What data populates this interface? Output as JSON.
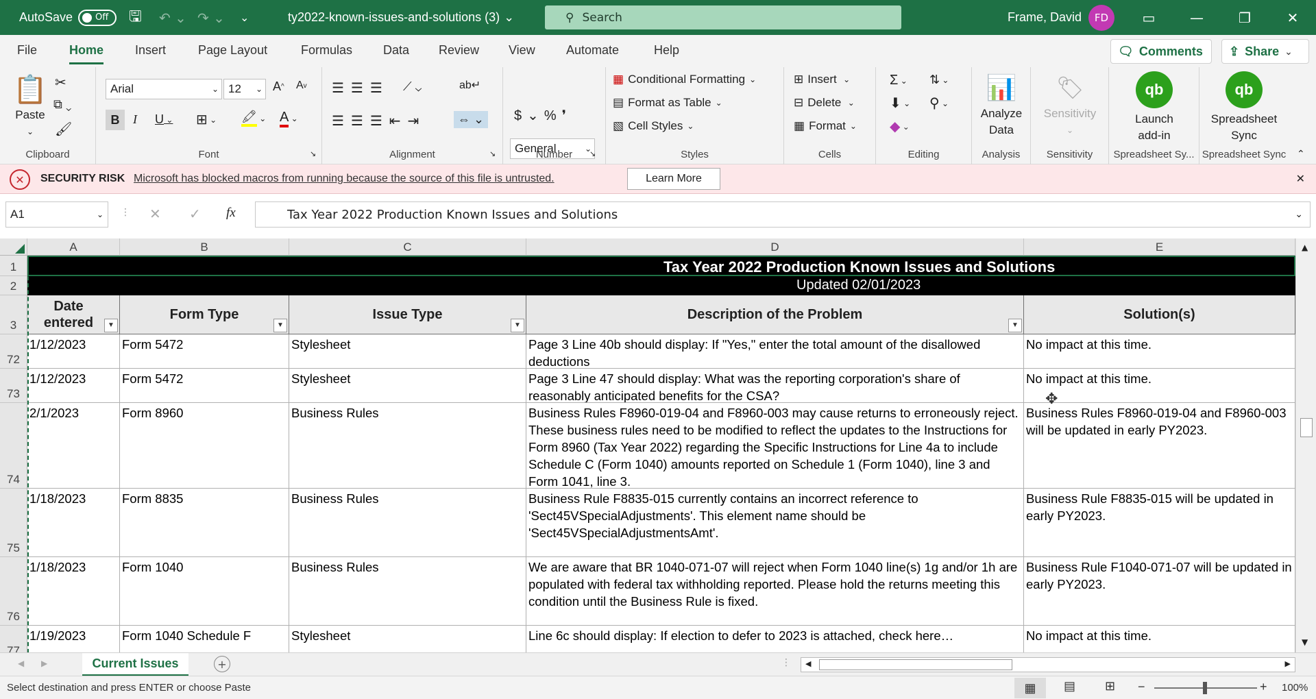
{
  "titlebar": {
    "autosave_label": "AutoSave",
    "autosave_state": "Off",
    "filename": "ty2022-known-issues-and-solutions (3)",
    "search_placeholder": "Search",
    "user_name": "Frame, David",
    "user_initials": "FD"
  },
  "menu": {
    "tabs": [
      "File",
      "Home",
      "Insert",
      "Page Layout",
      "Formulas",
      "Data",
      "Review",
      "View",
      "Automate",
      "Help"
    ],
    "active": "Home",
    "comments_label": "Comments",
    "share_label": "Share"
  },
  "ribbon": {
    "clipboard": {
      "paste": "Paste",
      "label": "Clipboard"
    },
    "font": {
      "family": "Arial",
      "size": "12",
      "label": "Font"
    },
    "alignment": {
      "label": "Alignment"
    },
    "number": {
      "format": "General",
      "label": "Number"
    },
    "styles": {
      "conditional": "Conditional Formatting",
      "table": "Format as Table",
      "cell": "Cell Styles",
      "label": "Styles"
    },
    "cells": {
      "insert": "Insert",
      "delete": "Delete",
      "format": "Format",
      "label": "Cells"
    },
    "editing": {
      "label": "Editing"
    },
    "analysis": {
      "analyze_line1": "Analyze",
      "analyze_line2": "Data",
      "label": "Analysis"
    },
    "sensitivity": {
      "button": "Sensitivity",
      "label": "Sensitivity"
    },
    "launch": {
      "line1": "Launch",
      "line2": "add-in",
      "label": "Spreadsheet Sy..."
    },
    "sync": {
      "line1": "Spreadsheet",
      "line2": "Sync",
      "label": "Spreadsheet Sync"
    }
  },
  "security": {
    "title": "SECURITY RISK",
    "message": "Microsoft has blocked macros from running because the source of this file is untrusted.",
    "learn_more": "Learn More"
  },
  "formula_bar": {
    "name_box": "A1",
    "content": "Tax Year 2022 Production Known Issues and Solutions"
  },
  "sheet": {
    "columns": [
      "A",
      "B",
      "C",
      "D",
      "E"
    ],
    "title": "Tax Year 2022 Production Known Issues and Solutions",
    "updated": "Updated 02/01/2023",
    "headers": {
      "date": "Date entered",
      "form": "Form Type",
      "issue": "Issue Type",
      "desc": "Description of the Problem",
      "solution": "Solution(s)"
    },
    "row_numbers": {
      "r1": "1",
      "r2": "2",
      "r3": "3"
    },
    "rows": [
      {
        "num": "72",
        "date": "1/12/2023",
        "form": "Form 5472",
        "issue": "Stylesheet",
        "desc": "Page 3 Line 40b should display: If \"Yes,\" enter the total amount of the disallowed deductions",
        "solution": "No impact at this time."
      },
      {
        "num": "73",
        "date": "1/12/2023",
        "form": "Form 5472",
        "issue": "Stylesheet",
        "desc": "Page 3 Line 47 should display: What was the reporting corporation's share of reasonably anticipated benefits for the CSA?",
        "solution": "No impact at this time."
      },
      {
        "num": "74",
        "date": "2/1/2023",
        "form": "Form 8960",
        "issue": "Business Rules",
        "desc": "Business Rules F8960-019-04 and F8960-003 may cause returns to erroneously reject. These business rules need to be modified to reflect the updates to the Instructions for Form 8960 (Tax Year 2022) regarding the Specific Instructions for Line 4a to include Schedule C (Form 1040) amounts reported on Schedule 1 (Form 1040), line 3 and Form 1041, line 3.",
        "solution": "Business Rules F8960-019-04 and F8960-003 will be updated in early PY2023."
      },
      {
        "num": "75",
        "date": "1/18/2023",
        "form": "Form 8835",
        "issue": "Business Rules",
        "desc": "Business Rule F8835-015 currently contains an incorrect reference to 'Sect45VSpecialAdjustments'.  This element name should be 'Sect45VSpecialAdjustmentsAmt'.",
        "solution": "Business Rule F8835-015 will be updated in early PY2023."
      },
      {
        "num": "76",
        "date": "1/18/2023",
        "form": "Form 1040",
        "issue": "Business Rules",
        "desc": "We are aware that BR 1040-071-07 will reject when Form 1040 line(s) 1g and/or 1h are populated with federal tax withholding reported. Please hold the returns meeting this condition until the Business Rule is fixed.",
        "solution": "Business Rule F1040-071-07 will be updated in early PY2023."
      },
      {
        "num": "77",
        "date": "1/19/2023",
        "form": "Form 1040 Schedule F",
        "issue": "Stylesheet",
        "desc": "Line 6c should display: If election to defer to 2023 is attached, check here…",
        "solution": "No impact at this time."
      }
    ]
  },
  "sheet_tabs": {
    "active": "Current Issues"
  },
  "status": {
    "message": "Select destination and press ENTER or choose Paste",
    "zoom": "100%"
  }
}
